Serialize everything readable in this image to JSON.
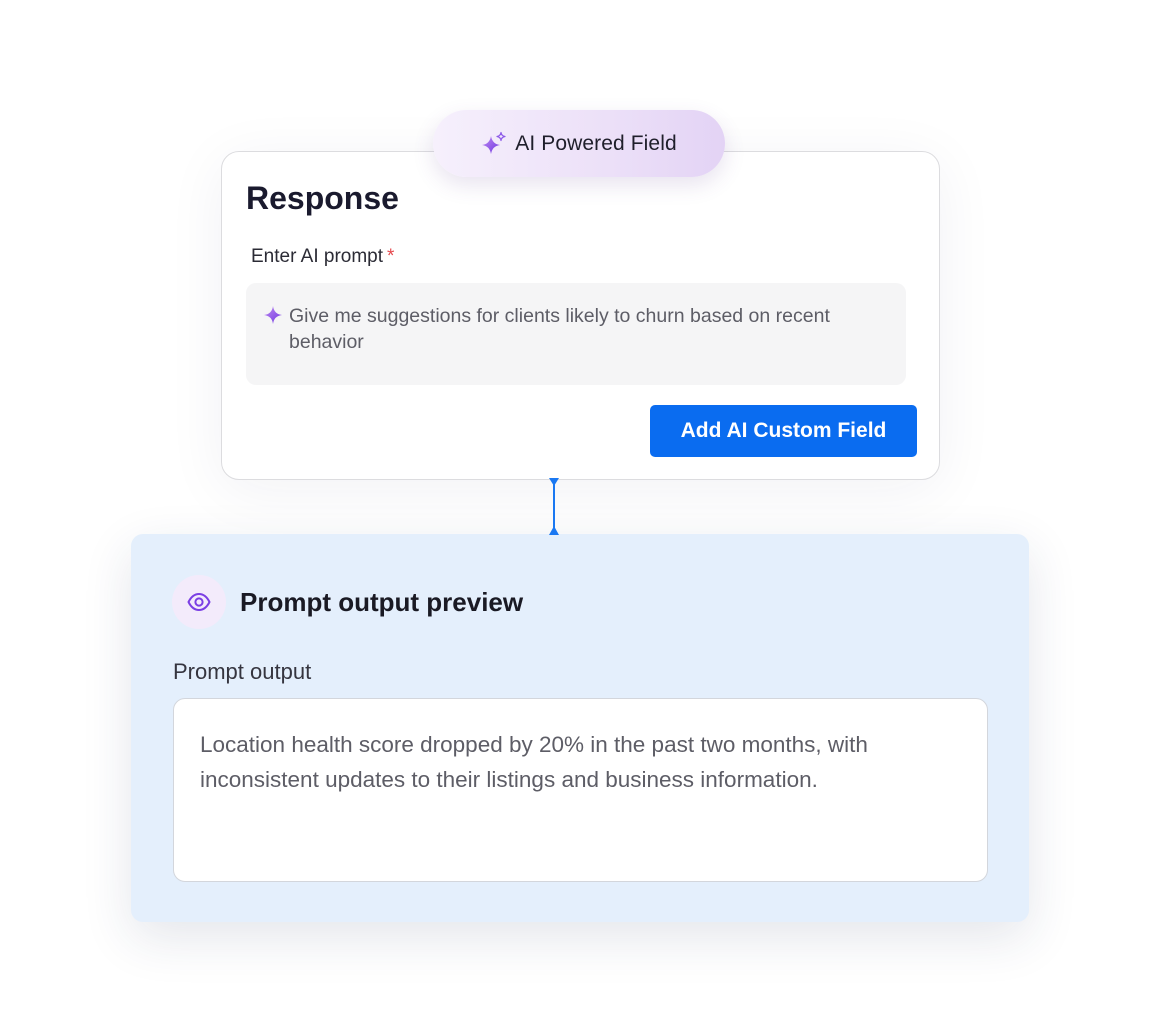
{
  "ai_badge": {
    "label": "AI Powered Field",
    "icon": "sparkles-icon",
    "gradient": [
      "#f6f0fc",
      "#e3d3f5"
    ]
  },
  "response_card": {
    "title": "Response",
    "prompt_label": "Enter AI prompt",
    "required_marker": "*",
    "prompt_icon": "sparkle-icon",
    "prompt_text": "Give me suggestions for clients likely to churn based on recent behavior",
    "submit_label": "Add AI Custom Field"
  },
  "preview": {
    "icon": "eye-icon",
    "title": "Prompt output preview",
    "output_label": "Prompt output",
    "output_text": "Location health score dropped by 20% in the past two months, with inconsistent updates to their listings and business information."
  },
  "colors": {
    "primary": "#0a6cf0",
    "accent_purple": "#7b3fe4",
    "required": "#e5484d",
    "panel_bg": "#e4effc",
    "connector": "#1a78f2"
  }
}
